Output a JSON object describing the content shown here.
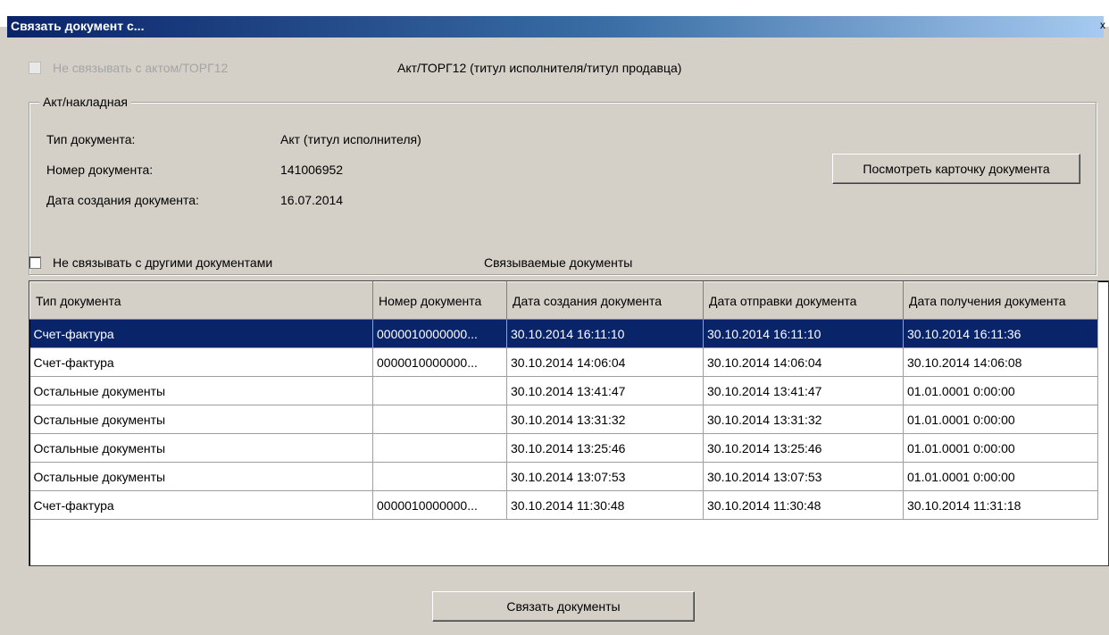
{
  "window": {
    "title": "Связать документ с...",
    "close_glyph": "x"
  },
  "act_checkbox": {
    "label": "Не связывать с актом/ТОРГ12",
    "checked": false,
    "disabled": true
  },
  "act_section_title": "Акт/ТОРГ12 (титул исполнителя/титул продавца)",
  "groupbox": {
    "legend": "Акт/накладная",
    "fields": [
      {
        "label": "Тип документа:",
        "value": "Акт (титул исполнителя)"
      },
      {
        "label": "Номер документа:",
        "value": "141006952"
      },
      {
        "label": "Дата создания документа:",
        "value": "16.07.2014"
      }
    ],
    "view_button": "Посмотреть карточку документа"
  },
  "other_checkbox": {
    "label": "Не связывать с другими документами",
    "checked": false
  },
  "linked_title": "Связываемые документы",
  "table": {
    "columns": [
      "Тип документа",
      "Номер документа",
      "Дата создания документа",
      "Дата отправки документа",
      "Дата получения документа"
    ],
    "rows": [
      [
        "Счет-фактура",
        "0000010000000...",
        "30.10.2014 16:11:10",
        "30.10.2014 16:11:10",
        "30.10.2014 16:11:36"
      ],
      [
        "Счет-фактура",
        "0000010000000...",
        "30.10.2014 14:06:04",
        "30.10.2014 14:06:04",
        "30.10.2014 14:06:08"
      ],
      [
        "Остальные документы",
        "",
        "30.10.2014 13:41:47",
        "30.10.2014 13:41:47",
        "01.01.0001 0:00:00"
      ],
      [
        "Остальные документы",
        "",
        "30.10.2014 13:31:32",
        "30.10.2014 13:31:32",
        "01.01.0001 0:00:00"
      ],
      [
        "Остальные документы",
        "",
        "30.10.2014 13:25:46",
        "30.10.2014 13:25:46",
        "01.01.0001 0:00:00"
      ],
      [
        "Остальные документы",
        "",
        "30.10.2014 13:07:53",
        "30.10.2014 13:07:53",
        "01.01.0001 0:00:00"
      ],
      [
        "Счет-фактура",
        "0000010000000...",
        "30.10.2014 11:30:48",
        "30.10.2014 11:30:48",
        "30.10.2014 11:31:18"
      ]
    ],
    "selected_row": 0
  },
  "link_button": "Связать документы",
  "colors": {
    "selection": "#0a246a",
    "title_start": "#0a246a",
    "title_end": "#a6caf0",
    "window_bg": "#d4d0c8"
  }
}
